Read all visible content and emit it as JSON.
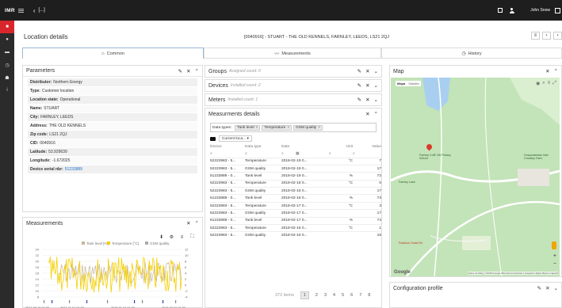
{
  "topbar": {
    "logo": "IMR",
    "back_icon": "chevron-left-icon",
    "breadcrumb": "[...]",
    "user_name": "John Snow"
  },
  "sidebar": {
    "items": [
      {
        "icon": "grid-icon",
        "glyph": "■",
        "active": true
      },
      {
        "icon": "location-icon",
        "glyph": "●",
        "active": false
      },
      {
        "icon": "truck-icon",
        "glyph": "▬",
        "active": false
      },
      {
        "icon": "clock-icon",
        "glyph": "◷",
        "active": false
      },
      {
        "icon": "users-icon",
        "glyph": "☗",
        "active": false
      },
      {
        "icon": "info-icon",
        "glyph": "i",
        "active": false
      }
    ]
  },
  "page": {
    "title": "Location details",
    "reference": "[0040916] - STUART - THE OLD KENNELS, FARNLEY, LEEDS, LS21 2QJ",
    "tabs": [
      {
        "label": "Common",
        "icon": "home-icon",
        "glyph": "⌂",
        "active": true
      },
      {
        "label": "Measurements",
        "icon": "line-chart-icon",
        "glyph": "〰",
        "active": false
      },
      {
        "label": "History",
        "icon": "history-icon",
        "glyph": "◷",
        "active": false
      }
    ]
  },
  "parameters": {
    "title": "Parameters",
    "rows": [
      {
        "label": "Distributor:",
        "value": "Northern Energy"
      },
      {
        "label": "Type:",
        "value": "Customer location"
      },
      {
        "label": "Location state:",
        "value": "Operational"
      },
      {
        "label": "Name:",
        "value": "STUART"
      },
      {
        "label": "City:",
        "value": "FARNLEY, LEEDS"
      },
      {
        "label": "Address:",
        "value": "THE OLD KENNELS"
      },
      {
        "label": "Zip code:",
        "value": "LS21 2QJ"
      },
      {
        "label": "CID:",
        "value": "0040916"
      },
      {
        "label": "Latitude:",
        "value": "53.929639"
      },
      {
        "label": "Longitude:",
        "value": "-1.672025"
      },
      {
        "label": "Device serial nbr:",
        "value": "51233889"
      }
    ]
  },
  "groups": {
    "title": "Groups",
    "sub": "Assigned count: 0"
  },
  "devices": {
    "title": "Devices",
    "sub": "Installed count: 2"
  },
  "meters": {
    "title": "Meters",
    "sub": "Installed count: 1"
  },
  "details": {
    "title": "Measurments details",
    "chips_label": "Data types:",
    "chips": [
      "Tank level",
      "Temperature",
      "GSM quality"
    ],
    "location_filter": "Current loca...",
    "columns": [
      "Device",
      "Data type",
      "Date",
      "Unit",
      "Value"
    ],
    "rows": [
      [
        "52223983 - 5...",
        "Temperature",
        "2018-02-19 0...",
        "°C",
        "7"
      ],
      [
        "52223983 - 5...",
        "GSM quality",
        "2018-02-19 0...",
        "",
        "17"
      ],
      [
        "51233889 - 0...",
        "Tank level",
        "2018-02-19 0...",
        "%",
        "72"
      ],
      [
        "52223983 - 5...",
        "Temperature",
        "2018-02-18 0...",
        "°C",
        "0"
      ],
      [
        "52223983 - 5...",
        "GSM quality",
        "2018-02-18 0...",
        "",
        "17"
      ],
      [
        "51233889 - 0...",
        "Tank level",
        "2018-02-18 0...",
        "%",
        "73"
      ],
      [
        "52223983 - 5...",
        "Temperature",
        "2018-02-17 0...",
        "°C",
        "3"
      ],
      [
        "52223983 - 5...",
        "GSM quality",
        "2018-02-17 0...",
        "",
        "17"
      ],
      [
        "51233889 - 0...",
        "Tank level",
        "2018-02-17 0...",
        "%",
        "74"
      ],
      [
        "52223983 - 5...",
        "Temperature",
        "2018-02-16 0...",
        "°C",
        "1"
      ],
      [
        "52223983 - 5...",
        "GSM quality",
        "2018-02-16 0...",
        "",
        "16"
      ]
    ],
    "pager": {
      "total": "372 items",
      "pages": [
        "1",
        "2",
        "3",
        "4",
        "5",
        "6",
        "7",
        "8"
      ],
      "current": "1"
    }
  },
  "measurements": {
    "title": "Measurements",
    "chart_data": {
      "type": "line",
      "series": [
        {
          "name": "Tank level [%]",
          "color": "#c8b79a"
        },
        {
          "name": "Temperature [°C]",
          "color": "#f5d000"
        },
        {
          "name": "GSM quality",
          "color": "#aaaaaa"
        }
      ],
      "y_left_ticks": [
        "24",
        "22",
        "20",
        "18",
        "16",
        "14",
        "12",
        "10",
        "8"
      ],
      "y_right_ticks": [
        "12",
        "10",
        "8",
        "6",
        "4",
        "2",
        "0",
        "-2",
        "-4"
      ],
      "x_ticks": [
        "2017-09-16 01:00",
        "2017-11-01 01:00",
        "2018-01-01 01:00",
        "2018-03-01 01:00"
      ]
    }
  },
  "map": {
    "title": "Map",
    "type_buttons": [
      "Mapa",
      "Satelita"
    ],
    "labels": [
      "Farnley CofE VA Primary School",
      "Gospodarstwo Iske Crossley Farm",
      "Farnley Lane",
      "Paddock Ovals Rd"
    ],
    "google": "Google",
    "footer": "Dane do Mapy ©2018 Google   Warunki korzystania z programu   Zgłoś błąd w mapach"
  },
  "config": {
    "title": "Configuration profile"
  }
}
